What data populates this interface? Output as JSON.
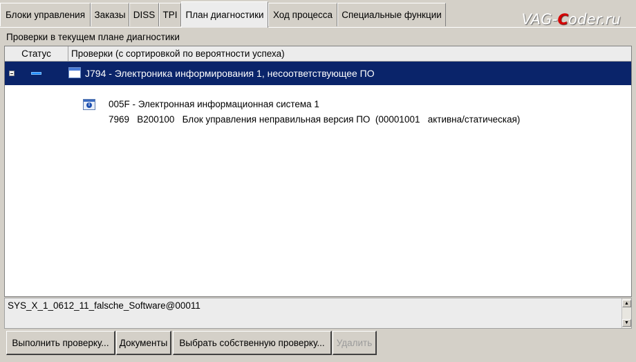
{
  "tabs": [
    {
      "label": "Блоки управления",
      "active": false
    },
    {
      "label": "Заказы",
      "active": false
    },
    {
      "label": "DISS",
      "active": false
    },
    {
      "label": "TPI",
      "active": false
    },
    {
      "label": "План диагностики",
      "active": true
    },
    {
      "label": "Ход процесса",
      "active": false
    },
    {
      "label": "Специальные функции",
      "active": false
    }
  ],
  "watermark": {
    "prefix": "VAG-",
    "c": "C",
    "suffix": "oder.ru"
  },
  "group_label": "Проверки в текущем плане диагностики",
  "grid": {
    "headers": {
      "status": "Статус",
      "checks": "Проверки (с сортировкой по вероятности успеха)"
    },
    "selected_row": {
      "text": "J794 - Электроника информирования 1, несоответствующее ПО"
    },
    "child": {
      "line1": "005F - Электронная информационная система 1",
      "line2": "7969   B200100   Блок управления неправильная версия ПО  (00001001   активна/статическая)"
    }
  },
  "code_text": "SYS_X_1_0612_11_falsche_Software@00011",
  "buttons": {
    "run": "Выполнить проверку...",
    "docs": "Документы",
    "choose": "Выбрать собственную проверку...",
    "delete": "Удалить"
  },
  "colors": {
    "selection": "#0a246a",
    "status_indicator": "#1e8cff",
    "watermark_c": "#d60000"
  }
}
